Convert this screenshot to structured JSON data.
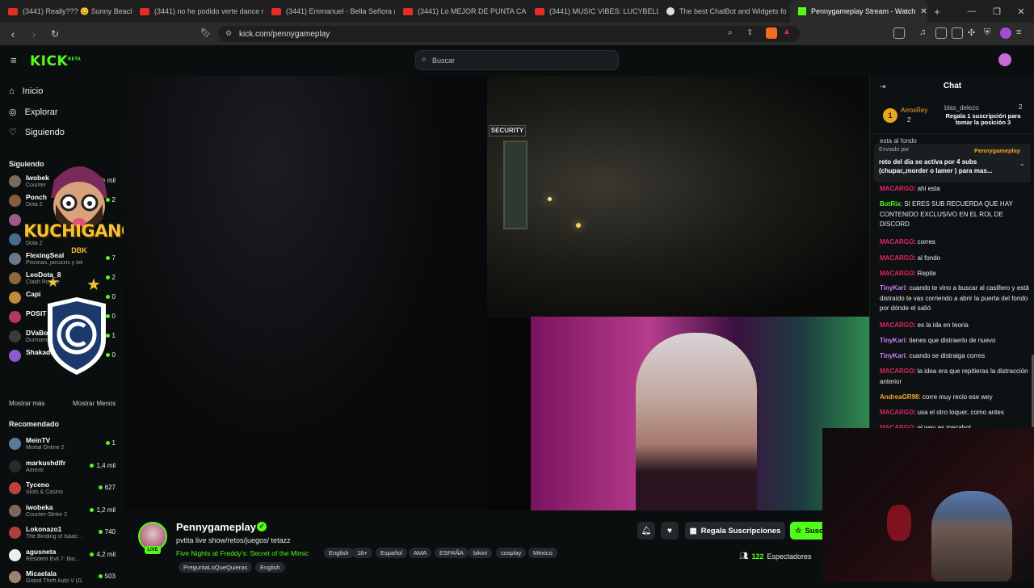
{
  "browser": {
    "tabs": [
      {
        "label": "(3441) Really??? 😊 Sunny Beach W",
        "kind": "youtube"
      },
      {
        "label": "(3441) no he podido verte dance m",
        "kind": "youtube"
      },
      {
        "label": "(3441) Emmanuel - Bella Señora (Ext",
        "kind": "youtube"
      },
      {
        "label": "(3441) Lo MEJOR DE PUNTA CANA",
        "kind": "youtube"
      },
      {
        "label": "(3441) MUSIC VIBES: LUCYBELL | by",
        "kind": "youtube"
      },
      {
        "label": "The best ChatBot and Widgets fo",
        "kind": "chatbot"
      }
    ],
    "active_tab": "Pennygameplay Stream - Watch",
    "url": "kick.com/pennygameplay"
  },
  "header": {
    "logo": "KICK",
    "logo_badge": "BETA",
    "search_placeholder": "Buscar"
  },
  "sidebar": {
    "nav": [
      {
        "label": "Inicio",
        "icon": "home-icon"
      },
      {
        "label": "Explorar",
        "icon": "compass-icon"
      },
      {
        "label": "Siguiendo",
        "icon": "heart-icon"
      }
    ],
    "following_title": "Siguiendo",
    "following": [
      {
        "name": "Iwobek",
        "game": "Counter",
        "viewers": "mil",
        "color": "#7b6a5c"
      },
      {
        "name": "Ponch",
        "game": "Dota 2",
        "viewers": "2",
        "color": "#8d5a3b"
      },
      {
        "name": "",
        "game": "",
        "viewers": "",
        "color": "#a05a8a"
      },
      {
        "name": "",
        "game": "Dota 2",
        "viewers": "",
        "color": "#4a6a8a"
      },
      {
        "name": "FlexingSeal",
        "game": "Piscinas, jacuzzis y bikinis",
        "viewers": "7",
        "color": "#6a7a8a"
      },
      {
        "name": "LeoDota_8",
        "game": "Clash Royale",
        "viewers": "2",
        "color": "#8a6a3a"
      },
      {
        "name": "Capi",
        "game": "",
        "viewers": "0",
        "color": "#c08a3a"
      },
      {
        "name": "POSIT",
        "game": "",
        "viewers": "0",
        "color": "#b03a5a"
      },
      {
        "name": "DVaBoi",
        "game": "Durmiendo",
        "viewers": "1",
        "color": "#3a3a3a"
      },
      {
        "name": "Shakadoto",
        "game": "",
        "viewers": "0",
        "color": "#8a5ad0"
      }
    ],
    "show_more": "Mostrar más",
    "show_less": "Mostrar Menos",
    "recommended_title": "Recomendado",
    "recommended": [
      {
        "name": "MeinTV",
        "game": "Mortal Online 2",
        "viewers": "1",
        "color": "#5a7a9a"
      },
      {
        "name": "markushdlfr",
        "game": "Amenti",
        "viewers": "1,4 mil",
        "color": "#2a2a2a"
      },
      {
        "name": "Tyceno",
        "game": "Slots & Casino",
        "viewers": "627",
        "color": "#c04040"
      },
      {
        "name": "iwobeka",
        "game": "Counter-Strike 2",
        "viewers": "1,2 mil",
        "color": "#7b6a5c"
      },
      {
        "name": "Lokonazo1",
        "game": "The Binding of Isaac: ...",
        "viewers": "740",
        "color": "#b04040"
      },
      {
        "name": "agusneta",
        "game": "Resident Evil 7: Bio...",
        "viewers": "4,2 mil",
        "color": "#eeeeee"
      },
      {
        "name": "Micaelala",
        "game": "Grand Theft Auto V (G",
        "viewers": "503",
        "color": "#a08070"
      }
    ]
  },
  "overlay": {
    "brand": "KUCHIGANG",
    "brand_sub": "DBK"
  },
  "video": {
    "sign": "SECURITY"
  },
  "stream": {
    "name": "Pennygameplay",
    "live_badge": "LIVE",
    "title": "pvtita live show/retos/juegos/ tetazz",
    "game": "Five Nights at Freddy's: Secret of the Mimic",
    "tags": [
      "English",
      "18+",
      "Español",
      "AMA",
      "ESPAÑA",
      "bikini",
      "cosplay",
      "México",
      "PreguntaLoQueQuieras",
      "English"
    ],
    "gift_button": "Regala Suscripciones",
    "subscribe_button": "Suscribirse",
    "viewer_count": "122",
    "viewer_label": "Espectadores"
  },
  "chat": {
    "title": "Chat",
    "leaderboard": {
      "rank": "1",
      "first_name": "ArrosRey",
      "first_count": "2",
      "second_name": "blas_delezo",
      "second_count": "2",
      "gift_note": "Regala 1 suscripción para tomar la posición 3"
    },
    "top_fragment": "esta al fondo",
    "pinned": {
      "by_label": "Enviado por",
      "author": "Pennygameplay",
      "text": "reto del dia se activa por 4 subs (chupar,,morder o lamer ) para mas..."
    },
    "messages": [
      {
        "user": "MACARGO",
        "text": ": ahi esta",
        "color": "#e0245e"
      },
      {
        "user": "BotRix",
        "text": ": SI ERES SUB RECUERDA QUE HAY CONTENIDO EXCLUSIVO EN EL ROL DE DISCORD",
        "color": "#53fc18"
      },
      {
        "user": "MACARGO",
        "text": ": corres",
        "color": "#e0245e"
      },
      {
        "user": "MACARGO",
        "text": ": al fondo",
        "color": "#e0245e"
      },
      {
        "user": "MACARGO",
        "text": ": Repite",
        "color": "#e0245e"
      },
      {
        "user": "TinyKari",
        "text": ": cuando te vino a buscar al casillero y está distraído te vas corriendo a abrir la puerta del fondo por dónde el salió",
        "color": "#c77dff"
      },
      {
        "user": "MACARGO",
        "text": ": es la ida en teoria",
        "color": "#e0245e"
      },
      {
        "user": "TinyKari",
        "text": ": tienes que distraerlo de nuevo",
        "color": "#c77dff"
      },
      {
        "user": "TinyKari",
        "text": ": cuando se distraiga corres",
        "color": "#c77dff"
      },
      {
        "user": "MACARGO",
        "text": ": la idea era que repitieras la distracción anterior",
        "color": "#e0245e"
      },
      {
        "user": "AndreaGR98",
        "text": ": corre muy recio ese wey",
        "color": "#f5a623"
      },
      {
        "user": "MACARGO",
        "text": ": usa el otro loquer, como antes",
        "color": "#e0245e"
      },
      {
        "user": "MACARGO",
        "text": ": el wey es mecabot",
        "color": "#e0245e"
      }
    ]
  },
  "colors": {
    "accent": "#53fc18",
    "background": "#0b0e0f"
  }
}
